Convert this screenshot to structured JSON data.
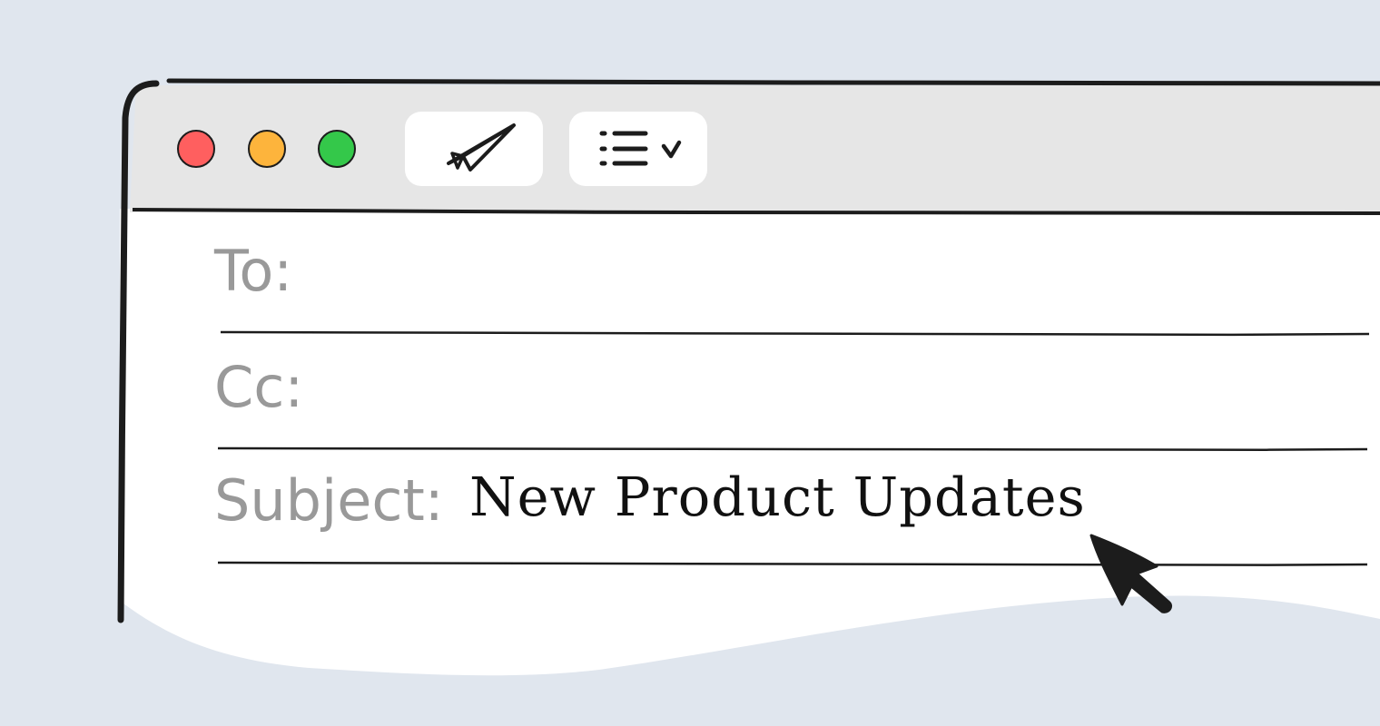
{
  "window": {
    "controls": [
      {
        "name": "close",
        "color": "#ff5f5f"
      },
      {
        "name": "minimize",
        "color": "#fdb43c"
      },
      {
        "name": "maximize",
        "color": "#34c84a"
      }
    ]
  },
  "toolbar": {
    "send_icon": "paper-plane-icon",
    "format_icon": "list-icon",
    "format_dropdown_icon": "chevron-down-icon"
  },
  "compose": {
    "to": {
      "label": "To:",
      "value": ""
    },
    "cc": {
      "label": "Cc:",
      "value": ""
    },
    "subject": {
      "label": "Subject:",
      "value": "New Product Updates"
    }
  },
  "colors": {
    "background": "#e0e6ee",
    "toolbar": "#e6e6e6",
    "label": "#999999",
    "outline": "#1c1c1c"
  }
}
